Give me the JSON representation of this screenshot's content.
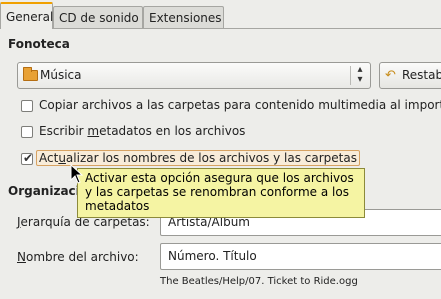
{
  "tabs": [
    {
      "label": "General",
      "active": true
    },
    {
      "label": "CD de sonido",
      "active": false
    },
    {
      "label": "Extensiones",
      "active": false
    }
  ],
  "library": {
    "section_title": "Fonoteca",
    "folder_combo": "Música",
    "restore_button": "Restab",
    "options": [
      {
        "label": "Copiar archivos a las carpetas para contenido multimedia al import",
        "checked": false
      },
      {
        "pre": "Escribir ",
        "mnemonic": "m",
        "post": "etadatos en los archivos",
        "checked": false
      },
      {
        "pre": "Act",
        "mnemonic": "u",
        "post": "alizar los nombres de los archivos y las carpetas",
        "checked": true
      }
    ]
  },
  "organization": {
    "section_title": "Organizaci",
    "folder_hierarchy_label_mnemonic": "J",
    "folder_hierarchy_label": "erarquía de carpetas:",
    "folder_hierarchy_value": "Artista/Álbum",
    "file_name_label_mnemonic": "N",
    "file_name_label": "ombre del archivo:",
    "file_name_value": "Número. Título",
    "example_path": "The Beatles/Help/07. Ticket to Ride.ogg"
  },
  "tooltip": "Activar esta opción asegura que los archivos y las carpetas se renombran conforme a los metadatos",
  "colors": {
    "window_bg": "#ededea",
    "tab_accent": "#f0a000",
    "tooltip_bg": "#f5f4a3",
    "highlight_border": "#d7a262"
  }
}
